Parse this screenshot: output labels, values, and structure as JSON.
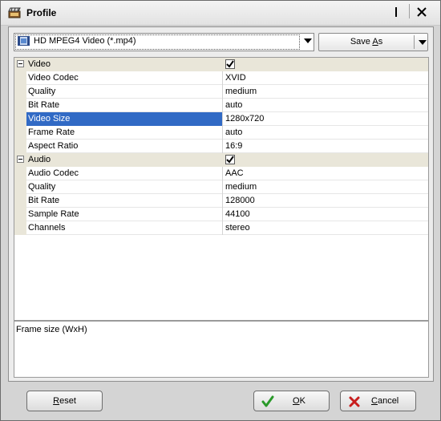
{
  "window": {
    "title": "Profile"
  },
  "format_combo": {
    "value": "HD MPEG4 Video (*.mp4)"
  },
  "save_as": {
    "label_pre": "Save ",
    "label_key": "A",
    "label_post": "s"
  },
  "properties": {
    "video": {
      "label": "Video",
      "checked": true,
      "items": [
        {
          "name": "Video Codec",
          "value": "XVID"
        },
        {
          "name": "Quality",
          "value": "medium"
        },
        {
          "name": "Bit Rate",
          "value": "auto"
        },
        {
          "name": "Video Size",
          "value": "1280x720"
        },
        {
          "name": "Frame Rate",
          "value": "auto"
        },
        {
          "name": "Aspect Ratio",
          "value": "16:9"
        }
      ]
    },
    "audio": {
      "label": "Audio",
      "checked": true,
      "items": [
        {
          "name": "Audio Codec",
          "value": "AAC"
        },
        {
          "name": "Quality",
          "value": "medium"
        },
        {
          "name": "Bit Rate",
          "value": "128000"
        },
        {
          "name": "Sample Rate",
          "value": "44100"
        },
        {
          "name": "Channels",
          "value": "stereo"
        }
      ]
    }
  },
  "description": {
    "text": "Frame size (WxH)"
  },
  "buttons": {
    "reset": {
      "key": "R",
      "rest": "eset"
    },
    "ok": {
      "key": "O",
      "rest": "K"
    },
    "cancel": {
      "key": "C",
      "rest": "ancel"
    }
  },
  "colors": {
    "selection": "#316ac5",
    "category_bg": "#e9e6d9",
    "ok_icon": "#2a9a2a",
    "cancel_icon": "#c81e1e"
  },
  "icons": [
    "clapper-icon",
    "video-file-icon",
    "checkmark-icon",
    "cross-icon"
  ]
}
